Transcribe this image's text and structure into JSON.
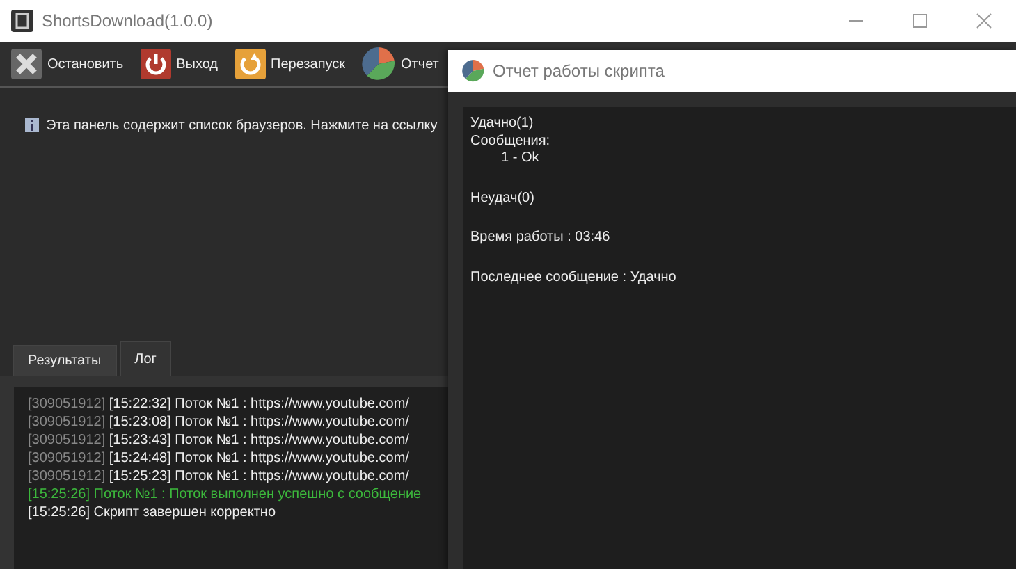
{
  "window": {
    "title": "ShortsDownload(1.0.0)"
  },
  "toolbar": [
    {
      "label": "Остановить",
      "kind": "stop"
    },
    {
      "label": "Выход",
      "kind": "exit"
    },
    {
      "label": "Перезапуск",
      "kind": "restart"
    },
    {
      "label": "Отчет",
      "kind": "report"
    }
  ],
  "info": "Эта панель содержит список браузеров. Нажмите на ссылку",
  "tabs": [
    {
      "label": "Результаты",
      "selected": false
    },
    {
      "label": "Лог",
      "selected": true
    }
  ],
  "log": [
    {
      "kind": "normal",
      "prefix": "[309051912]",
      "text": "[15:22:32] Поток №1 : https://www.youtube.com/"
    },
    {
      "kind": "normal",
      "prefix": "[309051912]",
      "text": "[15:23:08] Поток №1 : https://www.youtube.com/"
    },
    {
      "kind": "normal",
      "prefix": "[309051912]",
      "text": "[15:23:43] Поток №1 : https://www.youtube.com/"
    },
    {
      "kind": "normal",
      "prefix": "[309051912]",
      "text": "[15:24:48] Поток №1 : https://www.youtube.com/"
    },
    {
      "kind": "normal",
      "prefix": "[309051912]",
      "text": "[15:25:23] Поток №1 : https://www.youtube.com/"
    },
    {
      "kind": "success",
      "text": "[15:25:26] Поток №1 : Поток выполнен успешно с сообщение"
    },
    {
      "kind": "plain",
      "text": "[15:25:26] Скрипт завершен корректно"
    }
  ],
  "dialog": {
    "title": "Отчет работы скрипта",
    "sections": [
      [
        {
          "kind": "line",
          "text": "Удачно(1)"
        },
        {
          "kind": "line",
          "text": "Сообщения:"
        },
        {
          "kind": "sub",
          "text": "1 - Ok"
        }
      ],
      [
        {
          "kind": "line",
          "text": "Неудач(0)"
        }
      ],
      [
        {
          "kind": "line",
          "text": "Время работы : 03:46"
        }
      ],
      [
        {
          "kind": "line",
          "text": "Последнее сообщение : Удачно"
        }
      ]
    ]
  }
}
